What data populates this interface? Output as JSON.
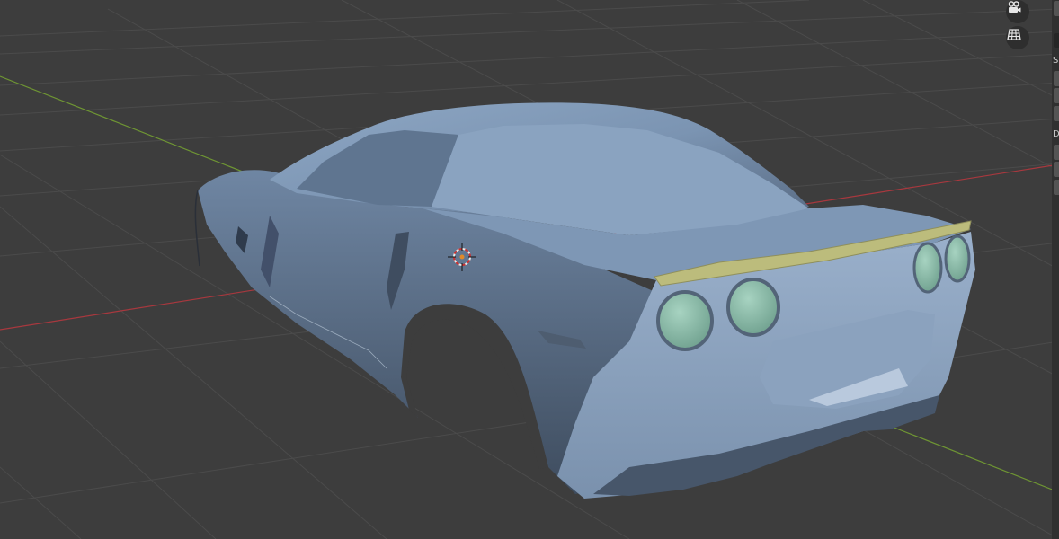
{
  "app": "Blender",
  "viewport": {
    "background": "#3d3d3d",
    "grid_color": "#4a4a4a",
    "x_axis_color": "#a8383e",
    "y_axis_color": "#6f9633",
    "object": "car body",
    "material_colors": {
      "body": "#7f99b7",
      "spoiler": "#bcbc7c",
      "tail_lights": "#8fbfae"
    }
  },
  "navigation": {
    "camera_icon": "camera-view-icon",
    "grid_icon": "perspective-ortho-toggle-icon"
  },
  "sidebar": {
    "label_1": "S",
    "label_2": "D"
  }
}
